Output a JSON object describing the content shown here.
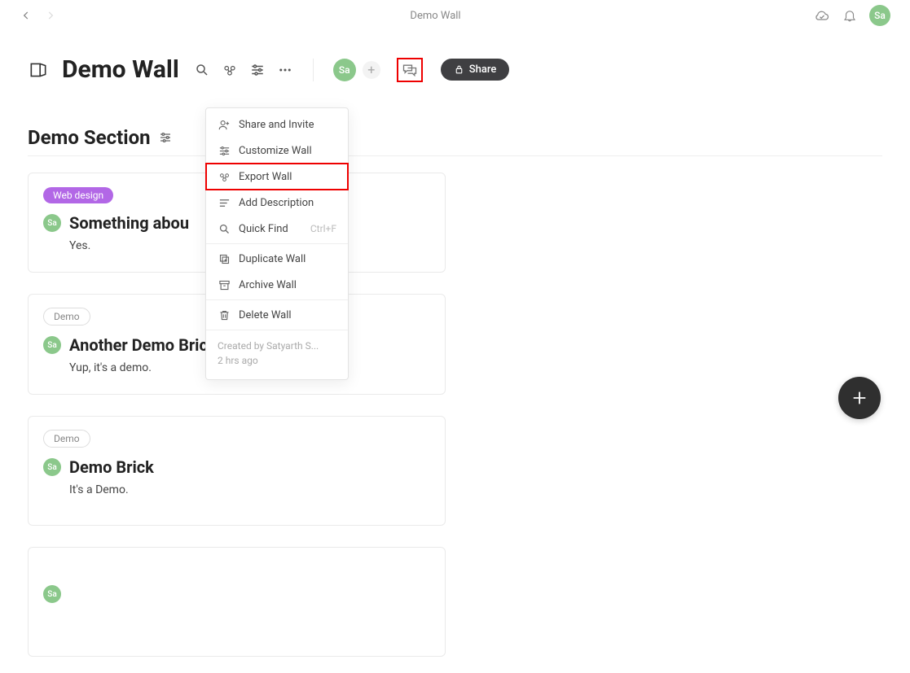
{
  "top": {
    "title": "Demo Wall",
    "avatar": "Sa"
  },
  "header": {
    "title": "Demo Wall",
    "collab_avatar": "Sa",
    "share_label": "Share"
  },
  "dropdown": {
    "items": [
      {
        "icon": "share",
        "label": "Share and Invite"
      },
      {
        "icon": "sliders",
        "label": "Customize Wall"
      },
      {
        "icon": "export",
        "label": "Export Wall",
        "highlight": true
      },
      {
        "icon": "desc",
        "label": "Add Description"
      },
      {
        "icon": "search",
        "label": "Quick Find",
        "shortcut": "Ctrl+F"
      },
      {
        "sep": true
      },
      {
        "icon": "duplicate",
        "label": "Duplicate Wall"
      },
      {
        "icon": "archive",
        "label": "Archive Wall"
      },
      {
        "sep": true
      },
      {
        "icon": "trash",
        "label": "Delete Wall"
      }
    ],
    "footer_line1": "Created by Satyarth S...",
    "footer_line2": "2 hrs ago"
  },
  "section": {
    "title": "Demo Section"
  },
  "cards": [
    {
      "tag": "Web design",
      "tag_style": "purple",
      "avatar": "Sa",
      "title": "Something abou",
      "body": "Yes."
    },
    {
      "tag": "Demo",
      "tag_style": "grey",
      "avatar": "Sa",
      "title": "Another Demo Brick",
      "body": "Yup, it's a demo."
    },
    {
      "tag": "Demo",
      "tag_style": "grey",
      "avatar": "Sa",
      "title": "Demo Brick",
      "body": "It's a Demo."
    },
    {
      "avatar_only": "Sa"
    }
  ]
}
